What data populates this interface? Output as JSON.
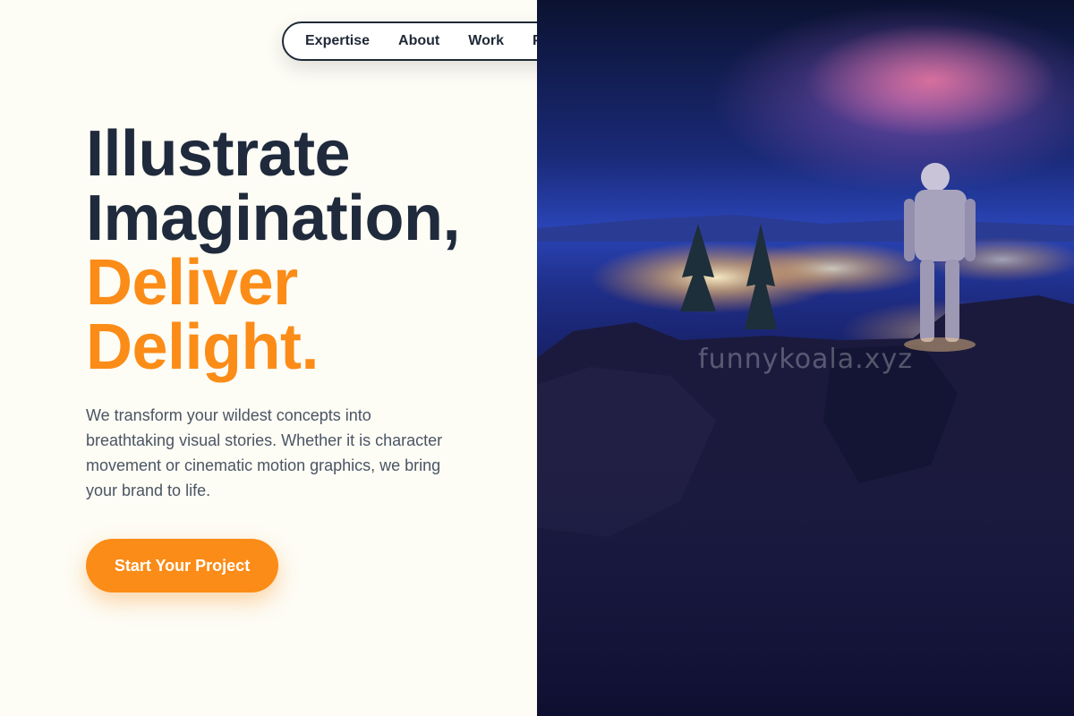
{
  "nav": {
    "items": [
      "Expertise",
      "About",
      "Work",
      "P"
    ]
  },
  "hero": {
    "headline_line1": "Illustrate",
    "headline_line2": "Imagination,",
    "headline_accent1": "Deliver",
    "headline_accent2": "Delight.",
    "description": "We transform your wildest concepts into breathtaking visual stories. Whether it is character movement or cinematic motion graphics, we bring your brand to life.",
    "cta_label": "Start Your Project"
  },
  "image": {
    "watermark": "funnykoala.xyz"
  },
  "colors": {
    "background": "#fdfcf5",
    "headline": "#1f2a3c",
    "accent": "#fb8c17",
    "body_text": "#4b5563"
  }
}
